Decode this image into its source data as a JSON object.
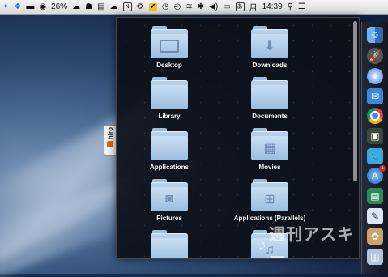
{
  "menubar": {
    "battery_percent": "26%",
    "input_method": "あ",
    "day": "月",
    "time": "14:39",
    "items": [
      "bluetooth-icon",
      "dropbox-icon",
      "tool-icon",
      "compass-icon",
      "battery-icon",
      "cloud-icon",
      "app-icon",
      "notes-icon",
      "app-icon",
      "gear-icon",
      "checkmark-icon",
      "clock-icon",
      "timemachine-icon",
      "wifi-icon",
      "bluetooth-icon",
      "volume-icon"
    ]
  },
  "stack": {
    "items": [
      {
        "label": "Desktop",
        "icon": "desktop-folder-icon"
      },
      {
        "label": "Downloads",
        "icon": "downloads-folder-icon"
      },
      {
        "label": "Library",
        "icon": "library-folder-icon"
      },
      {
        "label": "Documents",
        "icon": "documents-folder-icon"
      },
      {
        "label": "Applications",
        "icon": "applications-folder-icon"
      },
      {
        "label": "Movies",
        "icon": "movies-folder-icon"
      },
      {
        "label": "Pictures",
        "icon": "pictures-folder-icon"
      },
      {
        "label": "Applications (Parallels)",
        "icon": "parallels-folder-icon"
      },
      {
        "label": "",
        "icon": "folder-icon"
      },
      {
        "label": "",
        "icon": "music-folder-icon"
      }
    ]
  },
  "side_tab": {
    "label": "hiro"
  },
  "dock": {
    "icons": [
      "finder-icon",
      "launchpad-icon",
      "safari-icon",
      "mail-icon",
      "chrome-icon",
      "photo-booth-icon",
      "twitter-icon",
      "app-store-icon",
      "preview-icon",
      "textedit-icon",
      "photos-icon",
      "terminal-icon"
    ],
    "badge_count": "1"
  },
  "watermark": {
    "text": "週刊アスキー"
  }
}
